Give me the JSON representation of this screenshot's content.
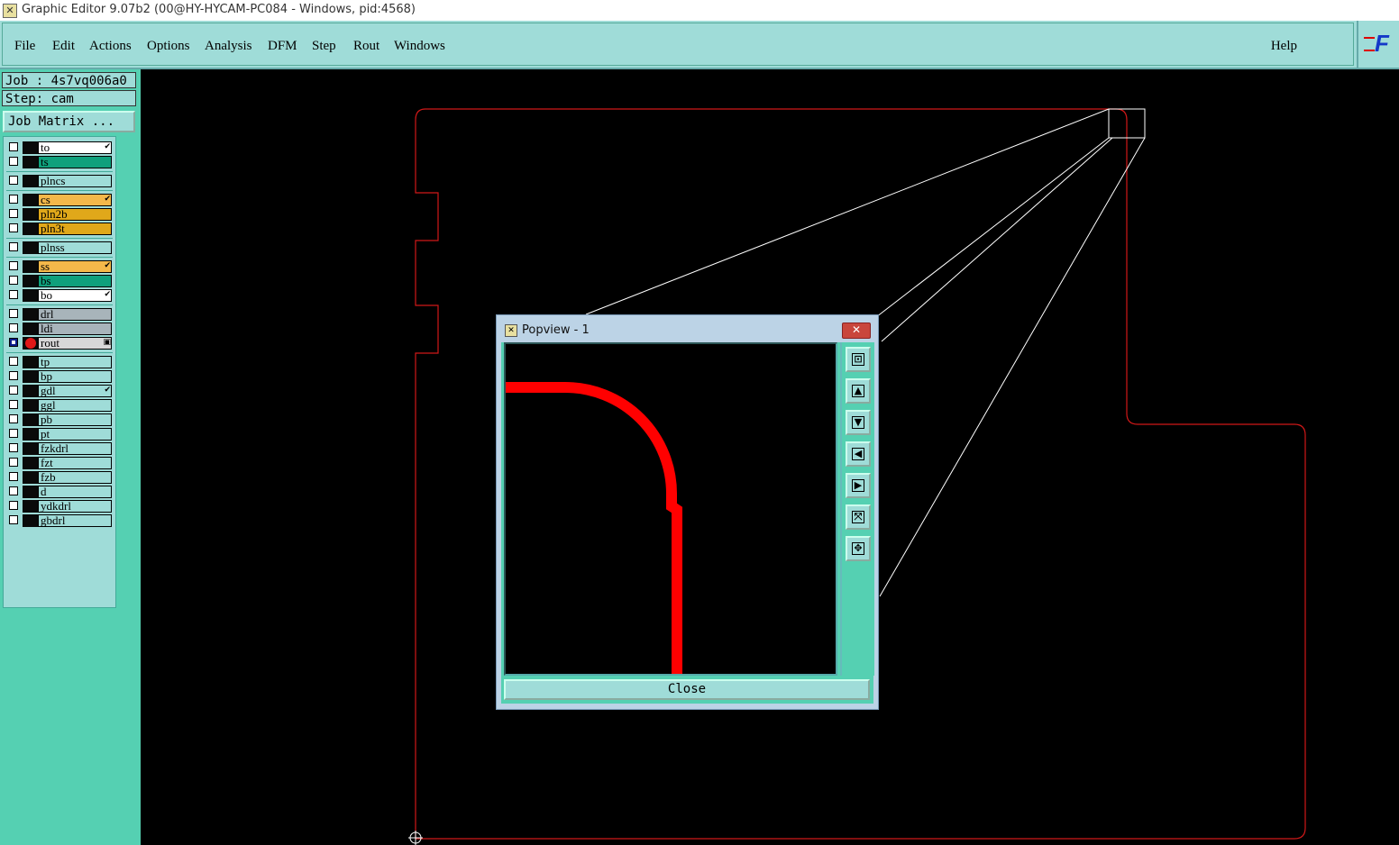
{
  "window": {
    "title": "Graphic Editor 9.07b2 (00@HY-HYCAM-PC084 - Windows, pid:4568)",
    "icon": "app-x-icon"
  },
  "menu": {
    "items": [
      "File",
      "Edit",
      "Actions",
      "Options",
      "Analysis",
      "DFM",
      "Step",
      "Rout",
      "Windows"
    ],
    "help": "Help",
    "logo_text": "F"
  },
  "job": {
    "job_label": "Job : 4s7vq006a0",
    "step_label": "Step: cam",
    "matrix_button": "Job Matrix ..."
  },
  "layers": [
    {
      "name": "to",
      "color": "#ffffff",
      "flag": "✔"
    },
    {
      "name": "ts",
      "color": "#0fa07c",
      "flag": ""
    },
    {
      "name": "plncs",
      "color": "#9fdcd8",
      "flag": ""
    },
    {
      "name": "cs",
      "color": "#f4b84a",
      "flag": "✔"
    },
    {
      "name": "pln2b",
      "color": "#e0a81a",
      "flag": ""
    },
    {
      "name": "pln3t",
      "color": "#e0a81a",
      "flag": ""
    },
    {
      "name": "plnss",
      "color": "#9fdcd8",
      "flag": ""
    },
    {
      "name": "ss",
      "color": "#f4b84a",
      "flag": "✔"
    },
    {
      "name": "bs",
      "color": "#0fa07c",
      "flag": ""
    },
    {
      "name": "bo",
      "color": "#ffffff",
      "flag": "✔"
    },
    {
      "name": "drl",
      "color": "#a8b4ba",
      "flag": ""
    },
    {
      "name": "ldi",
      "color": "#a8b4ba",
      "flag": ""
    },
    {
      "name": "rout",
      "color": "#d8d8d8",
      "flag": "▣",
      "active": true
    },
    {
      "name": "tp",
      "color": "#9fdcd8",
      "flag": ""
    },
    {
      "name": "bp",
      "color": "#9fdcd8",
      "flag": ""
    },
    {
      "name": "gdl",
      "color": "#9fdcd8",
      "flag": "✔"
    },
    {
      "name": "ggl",
      "color": "#9fdcd8",
      "flag": ""
    },
    {
      "name": "pb",
      "color": "#9fdcd8",
      "flag": ""
    },
    {
      "name": "pt",
      "color": "#9fdcd8",
      "flag": ""
    },
    {
      "name": "fzkdrl",
      "color": "#9fdcd8",
      "flag": ""
    },
    {
      "name": "fzt",
      "color": "#9fdcd8",
      "flag": ""
    },
    {
      "name": "fzb",
      "color": "#9fdcd8",
      "flag": ""
    },
    {
      "name": "d",
      "color": "#9fdcd8",
      "flag": ""
    },
    {
      "name": "ydkdrl",
      "color": "#9fdcd8",
      "flag": ""
    },
    {
      "name": "gbdrl",
      "color": "#9fdcd8",
      "flag": ""
    }
  ],
  "popview": {
    "title": "Popview - 1",
    "close_x": "✕",
    "close_button": "Close",
    "tools": [
      "zoom-window-icon",
      "pan-up-icon",
      "pan-down-icon",
      "pan-left-icon",
      "pan-right-icon",
      "zoom-fit-icon",
      "zoom-center-icon"
    ]
  },
  "colors": {
    "outline": "#d01818",
    "rout": "#ff0000",
    "panel": "#55d0b2",
    "menubar": "#9fdcd8"
  }
}
